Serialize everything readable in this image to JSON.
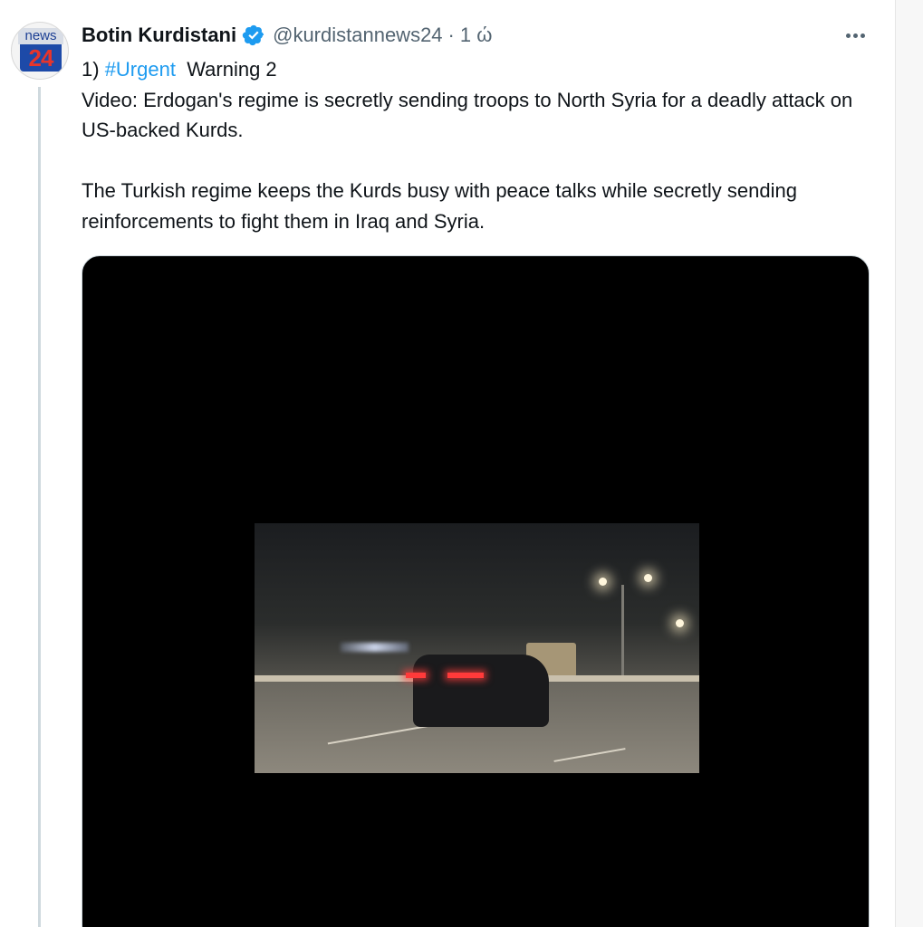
{
  "tweet": {
    "avatar": {
      "top_text": "news",
      "bottom_text": "24",
      "icon": "news24-logo"
    },
    "author": {
      "display_name": "Botin Kurdistani",
      "verified_icon": "verified-badge-icon",
      "handle": "@kurdistannews24",
      "separator": "·",
      "time": "1 ώ"
    },
    "more_icon": "more-horizontal-icon",
    "text": {
      "line1_prefix": "1)",
      "hashtag": "#Urgent",
      "line1_suffix": "Warning 2",
      "paragraph1": "Video: Erdogan's regime is secretly sending troops to North Syria for a deadly attack on US-backed Kurds.",
      "paragraph2": "The Turkish regime keeps the Kurds busy with peace talks while secretly sending reinforcements to fight them in Iraq and Syria."
    },
    "media": {
      "type": "video"
    }
  },
  "colors": {
    "text_primary": "#0f1419",
    "text_secondary": "#536471",
    "link": "#1d9bf0",
    "verified": "#1d9bf0"
  }
}
